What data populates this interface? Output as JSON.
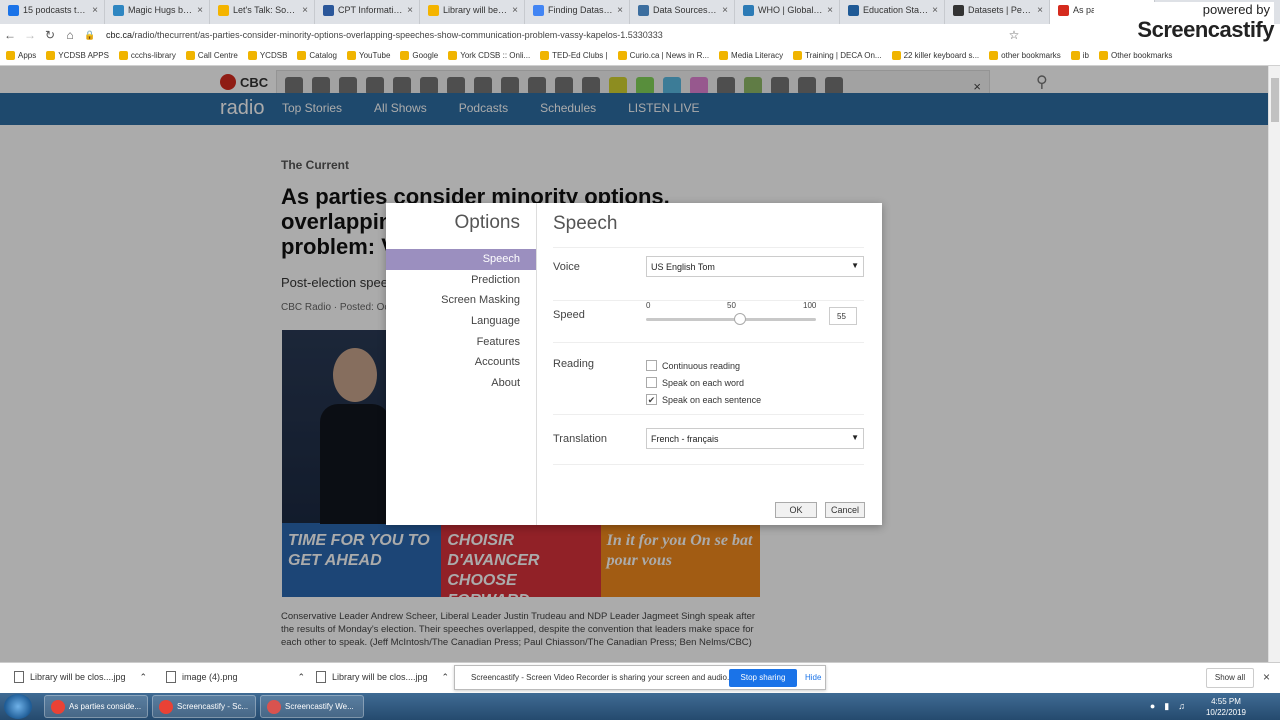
{
  "browser": {
    "tabs": [
      {
        "title": "15 podcasts that",
        "color": "#1a73e8"
      },
      {
        "title": "Magic Hugs by T",
        "color": "#2e86c1"
      },
      {
        "title": "Let's Talk: Social",
        "color": "#f4b400"
      },
      {
        "title": "CPT Information",
        "color": "#2b579a"
      },
      {
        "title": "Library will be clo",
        "color": "#f4b400"
      },
      {
        "title": "Finding Datasets",
        "color": "#4285f4"
      },
      {
        "title": "Data Sources on",
        "color": "#3c6e9f"
      },
      {
        "title": "WHO | Global He",
        "color": "#2c7bb6"
      },
      {
        "title": "Education Statisti",
        "color": "#1f5a96"
      },
      {
        "title": "Datasets | Pew Re",
        "color": "#333333"
      },
      {
        "title": "As parties co",
        "color": "#d52b1e"
      }
    ],
    "url_host": "cbc.ca",
    "url_path": "/radio/thecurrent/as-parties-consider-minority-options-overlapping-speeches-show-communication-problem-vassy-kapelos-1.5330333",
    "bookmarks": [
      "Apps",
      "YCDSB APPS",
      "ccchs-library",
      "Call Centre",
      "YCDSB",
      "Catalog",
      "YouTube",
      "Google",
      "York CDSB :: Onli...",
      "TED-Ed Clubs |",
      "Curio.ca | News in R...",
      "Media Literacy",
      "Training | DECA On...",
      "22 killer keyboard s...",
      "other bookmarks",
      "ib",
      "Other bookmarks"
    ],
    "watermark_small": "powered by",
    "watermark_big": "Screencastify"
  },
  "page": {
    "cbc_label": "CBC",
    "radio_label": "radio",
    "nav": [
      "Top Stories",
      "All Shows",
      "Podcasts",
      "Schedules",
      "LISTEN LIVE"
    ],
    "show_name": "The Current",
    "headline": "As parties consider minority options, overlapping speeches show communication problem: Vassy",
    "subhead": "Post-election speeches",
    "byline": "CBC Radio · Posted: Oct",
    "banner1": "TIME FOR YOU TO GET AHEAD",
    "banner2": "CHOISIR D'AVANCER CHOOSE FORWARD",
    "banner3": "In it for you On se bat pour vous",
    "caption": "Conservative Leader Andrew Scheer, Liberal Leader Justin Trudeau and NDP Leader Jagmeet Singh speak after the results of Monday's election. Their speeches overlapped, despite the convention that leaders make space for each other to speak. (Jeff McIntosh/The Canadian Press; Paul Chiasson/The Canadian Press; Ben Nelms/CBC)"
  },
  "dialog": {
    "side_title": "Options",
    "menu": [
      "Speech",
      "Prediction",
      "Screen Masking",
      "Language",
      "Features",
      "Accounts",
      "About"
    ],
    "main_title": "Speech",
    "voice_label": "Voice",
    "voice_value": "US English Tom",
    "speed_label": "Speed",
    "speed_min": "0",
    "speed_mid": "50",
    "speed_max": "100",
    "speed_value": "55",
    "speed_fraction": 0.55,
    "reading_label": "Reading",
    "reading_options": [
      {
        "label": "Continuous reading",
        "checked": false
      },
      {
        "label": "Speak on each word",
        "checked": false
      },
      {
        "label": "Speak on each sentence",
        "checked": true
      }
    ],
    "translation_label": "Translation",
    "translation_value": "French - français",
    "ok_label": "OK",
    "cancel_label": "Cancel",
    "accent_color": "#9b8fbf"
  },
  "downloads": {
    "items": [
      "Library will be clos....jpg",
      "image (4).png",
      "Library will be clos....jpg"
    ],
    "share_text": "Screencastify - Screen Video Recorder is sharing your screen and audio.",
    "stop_label": "Stop sharing",
    "hide_label": "Hide",
    "show_all": "Show all"
  },
  "taskbar": {
    "buttons": [
      "As parties conside...",
      "Screencastify - Sc...",
      "Screencastify We..."
    ],
    "time": "4:55 PM",
    "date": "10/22/2019"
  }
}
